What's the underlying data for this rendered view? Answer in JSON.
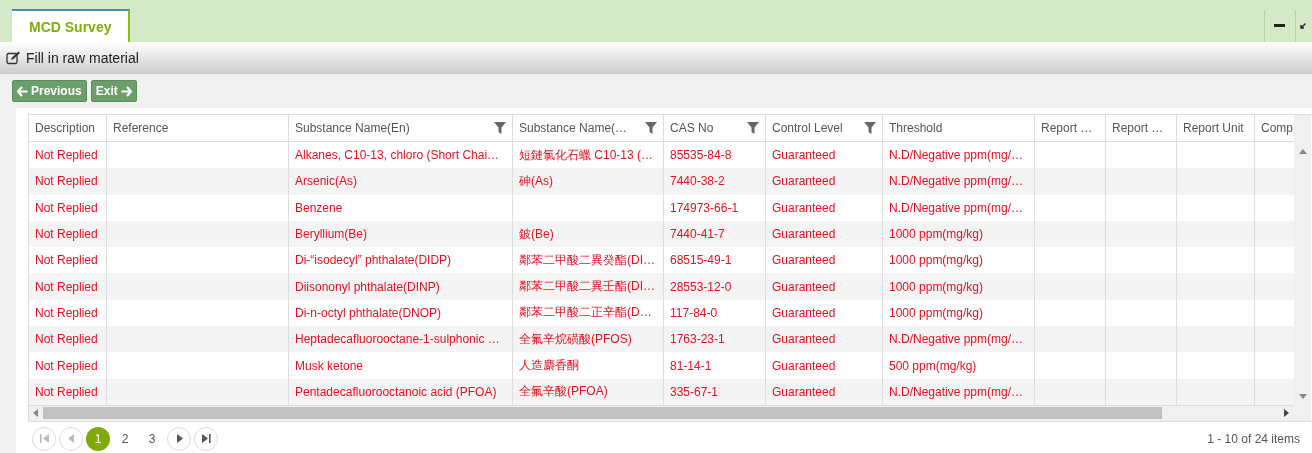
{
  "tabs": [
    {
      "label": "MCD Survey",
      "selected": true
    }
  ],
  "toolbar": {
    "title": "Fill in raw material"
  },
  "buttons": [
    {
      "kind": "back",
      "label": "Previous"
    },
    {
      "kind": "forward",
      "label": "Exit"
    }
  ],
  "table": {
    "columns": [
      {
        "label": "Description",
        "filter": false
      },
      {
        "label": "Reference",
        "filter": false
      },
      {
        "label": "Substance Name(En)",
        "filter": true
      },
      {
        "label": "Substance Name(…",
        "filter": true
      },
      {
        "label": "CAS No",
        "filter": true
      },
      {
        "label": "Control Level",
        "filter": true
      },
      {
        "label": "Threshold",
        "filter": false
      },
      {
        "label": "Report …",
        "filter": false
      },
      {
        "label": "Report …",
        "filter": false
      },
      {
        "label": "Report Unit",
        "filter": false
      },
      {
        "label": "Comp"
      }
    ],
    "rows": [
      {
        "description": "Not Replied",
        "name_en": "Alkanes, C10-13, chloro (Short Chai…",
        "name_zh": "短鏈氯化石蠟 C10-13 (…",
        "cas": "85535-84-8",
        "control_level": "Guaranteed",
        "threshold": "N.D/Negative ppm(mg/…"
      },
      {
        "description": "Not Replied",
        "name_en": "Arsenic(As)",
        "name_zh": "砷(As)",
        "cas": "7440-38-2",
        "control_level": "Guaranteed",
        "threshold": "N.D/Negative ppm(mg/…"
      },
      {
        "description": "Not Replied",
        "name_en": "Benzene",
        "cas": "174973-66-1",
        "control_level": "Guaranteed",
        "threshold": "N.D/Negative ppm(mg/…"
      },
      {
        "description": "Not Replied",
        "name_en": "Beryllium(Be)",
        "name_zh": "鈹(Be)",
        "cas": "7440-41-7",
        "control_level": "Guaranteed",
        "threshold": "1000 ppm(mg/kg)"
      },
      {
        "description": "Not Replied",
        "name_en": "Di-“isodecyl” phthalate(DIDP)",
        "name_zh": "鄰苯二甲酸二異癸酯(DI…",
        "cas": "68515-49-1",
        "control_level": "Guaranteed",
        "threshold": "1000 ppm(mg/kg)"
      },
      {
        "description": "Not Replied",
        "name_en": "Diisononyl phthalate(DINP)",
        "name_zh": "鄰苯二甲酸二異壬酯(DI…",
        "cas": "28553-12-0",
        "control_level": "Guaranteed",
        "threshold": "1000 ppm(mg/kg)"
      },
      {
        "description": "Not Replied",
        "name_en": "Di-n-octyl phthalate(DNOP)",
        "name_zh": "鄰苯二甲酸二正辛酯(D…",
        "cas": "117-84-0",
        "control_level": "Guaranteed",
        "threshold": "1000 ppm(mg/kg)"
      },
      {
        "description": "Not Replied",
        "name_en": "Heptadecafluorooctane-1-sulphonic …",
        "name_zh": "全氟辛烷磺酸(PFOS)",
        "cas": "1763-23-1",
        "control_level": "Guaranteed",
        "threshold": "N.D/Negative ppm(mg/…"
      },
      {
        "description": "Not Replied",
        "name_en": "Musk ketone",
        "name_zh": "人造麝香酮",
        "cas": "81-14-1",
        "control_level": "Guaranteed",
        "threshold": "500 ppm(mg/kg)"
      },
      {
        "description": "Not Replied",
        "name_en": "Pentadecafluorooctanoic acid (PFOA)",
        "name_zh": "全氟辛酸(PFOA)",
        "cas": "335-67-1",
        "control_level": "Guaranteed",
        "threshold": "N.D/Negative ppm(mg/…"
      }
    ]
  },
  "pager": {
    "pages": [
      {
        "label": "1",
        "selected": true
      },
      {
        "label": "2",
        "selected": false
      },
      {
        "label": "3",
        "selected": false
      }
    ],
    "summary": "1 - 10 of 24 items"
  }
}
